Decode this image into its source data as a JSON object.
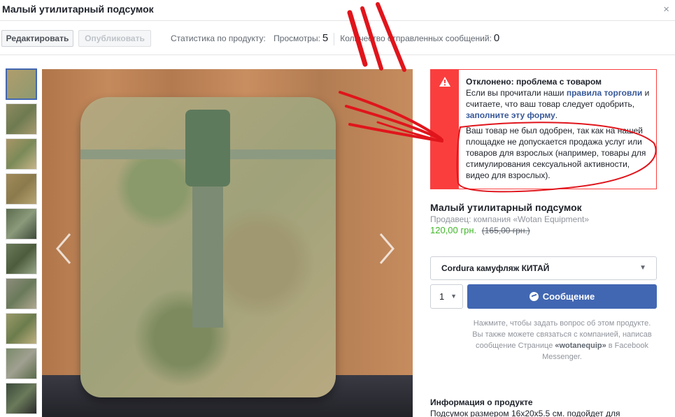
{
  "header": {
    "title": "Малый утилитарный подсумок",
    "close": "×"
  },
  "toolbar": {
    "edit_label": "Редактировать",
    "publish_label": "Опубликовать",
    "stats_label": "Статистика по продукту:",
    "views_label": "Просмотры:",
    "views_value": "5",
    "messages_label": "Количество отправленных сообщений:",
    "messages_value": "0"
  },
  "rejection": {
    "icon": "warning-icon",
    "heading": "Отклонено: проблема с товаром",
    "text1": "Если вы прочитали наши",
    "link1": "правила торговли",
    "text2": "и считаете, что ваш товар следует одобрить,",
    "link2": "заполните эту форму",
    "text3": ".",
    "reason": "Ваш товар не был одобрен, так как на нашей площадке не допускается продажа услуг или товаров для взрослых (например, товары для стимулирования сексуальной активности, видео для взрослых)."
  },
  "product": {
    "title": "Малый утилитарный подсумок",
    "seller": "Продавец: компания «Wotan Equipment»",
    "price": "120,00 грн.",
    "old_price": "(165,00 грн.)",
    "variant": "Cordura камуфляж КИТАЙ",
    "quantity": "1",
    "message_button": "Сообщение",
    "help_text1": "Нажмите, чтобы задать вопрос об этом продукте. Вы также можете связаться с компанией, написав сообщение Странице",
    "help_page": "«wotanequip»",
    "help_text2": "в Facebook Messenger.",
    "info_title": "Информация о продукте",
    "info_text": "Подсумок размером 16x20x5.5 см. подойдет для"
  },
  "colors": {
    "accent": "#4267b2",
    "error": "#fa3e3e",
    "price": "#42b72a",
    "annotation": "#e0151c"
  }
}
